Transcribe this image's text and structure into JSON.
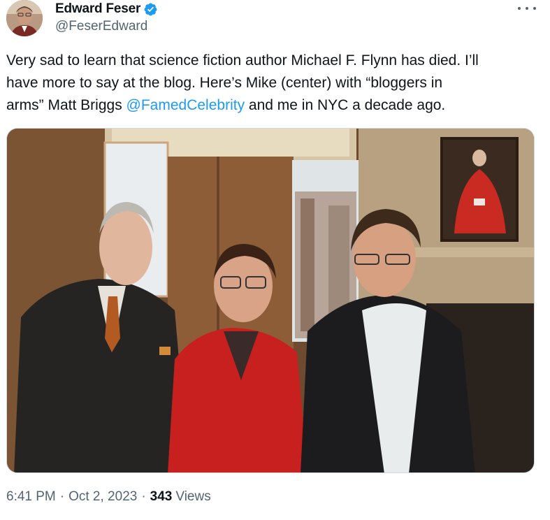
{
  "author": {
    "display_name": "Edward Feser",
    "handle": "@FeserEdward",
    "verified": true,
    "avatar_icon": "profile-photo"
  },
  "more_icon": "ellipsis-icon",
  "tweet": {
    "line1": "Very sad to learn that science fiction author Michael F. Flynn has died. I’ll",
    "line2": "have more to say at the blog. Here’s Mike (center) with “bloggers in",
    "line3_before": "arms” Matt Briggs ",
    "line3_mention": "@FamedCelebrity",
    "line3_after": " and me in NYC a decade ago."
  },
  "media": {
    "icon": "photo-three-men-in-room"
  },
  "meta": {
    "time": "6:41 PM",
    "separator": "·",
    "date": "Oct 2, 2023",
    "views_count": "343",
    "views_label": "Views"
  },
  "colors": {
    "accent": "#1d9bf0",
    "secondary_text": "#536471",
    "primary_text": "#0f1419"
  }
}
